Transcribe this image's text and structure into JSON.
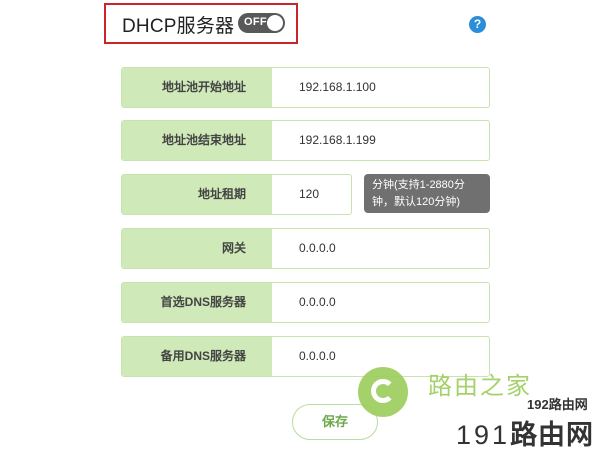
{
  "header": {
    "title": "DHCP服务器",
    "toggle_label": "OFF",
    "help_label": "?"
  },
  "fields": [
    {
      "label": "地址池开始地址",
      "value": "192.168.1.100"
    },
    {
      "label": "地址池结束地址",
      "value": "192.168.1.199"
    },
    {
      "label": "地址租期",
      "value": "120"
    },
    {
      "label": "网关",
      "value": "0.0.0.0"
    },
    {
      "label": "首选DNS服务器",
      "value": "0.0.0.0"
    },
    {
      "label": "备用DNS服务器",
      "value": "0.0.0.0"
    }
  ],
  "lease_hint": {
    "line1": "分钟(支持1-2880分",
    "line2": "钟，默认120分钟)"
  },
  "save_label": "保存",
  "watermark": {
    "brand": "路由之家",
    "site": "192路由网",
    "num": "191",
    "tail": "路由网"
  },
  "colors": {
    "label_bg": "#cfe9b8",
    "accent": "#9ccd5b",
    "highlight": "#c8262b",
    "toggle_bg": "#585858",
    "help": "#2a8fd8"
  }
}
